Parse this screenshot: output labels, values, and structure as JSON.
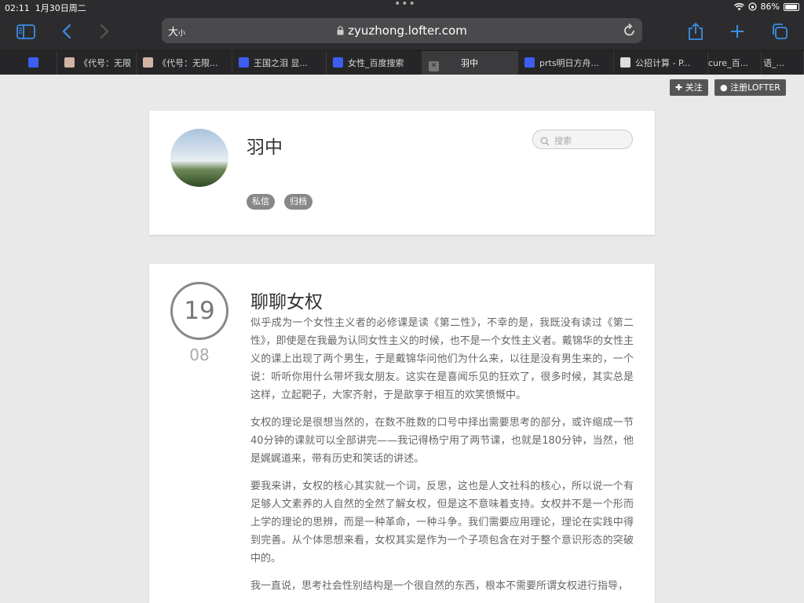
{
  "status": {
    "time": "02:11",
    "date": "1月30日周二",
    "battery": "86%",
    "battery_level": 0.86
  },
  "browser": {
    "text_size": "大",
    "text_size_small": "小",
    "url": "zyuzhong.lofter.com",
    "tabs": [
      {
        "label": "",
        "icon": "baidu-paw-icon"
      },
      {
        "label": "《代号：无限",
        "icon": "anime-avatar-icon"
      },
      {
        "label": "《代号：无限...",
        "icon": "anime-avatar-icon"
      },
      {
        "label": "王国之泪 显...",
        "icon": "baidu-paw-icon"
      },
      {
        "label": "女性_百度搜索",
        "icon": "baidu-paw-icon"
      },
      {
        "label": "羽中",
        "icon": "close-icon",
        "active": true
      },
      {
        "label": "prts明日方舟...",
        "icon": "baidu-paw-icon"
      },
      {
        "label": "公招计算 - P...",
        "icon": "page-icon"
      },
      {
        "label": "cure_百...",
        "icon": ""
      },
      {
        "label": "语_...",
        "icon": ""
      }
    ]
  },
  "lofter": {
    "follow_label": "关注",
    "register_label": "注册LOFTER"
  },
  "profile": {
    "name": "羽中",
    "search_placeholder": "搜索",
    "message_label": "私信",
    "archive_label": "归档"
  },
  "post": {
    "day": "19",
    "month": "08",
    "title": "聊聊女权",
    "paragraphs": [
      "似乎成为一个女性主义者的必修课是读《第二性》，不幸的是，我既没有读过《第二性》，即使是在我最为认同女性主义的时候，也不是一个女性主义者。戴锦华的女性主义的课上出现了两个男生，于是戴锦华问他们为什么来，以往是没有男生来的，一个说：听听你用什么带坏我女朋友。这实在是喜闻乐见的狂欢了，很多时候，其实总是这样，立起靶子，大家齐射，于是歆享于相互的欢笑愤慨中。",
      "女权的理论是很想当然的，在数不胜数的口号中择出需要思考的部分，或许缩成一节40分钟的课就可以全部讲完——我记得杨宁用了两节课，也就是180分钟，当然，他是娓娓道来，带有历史和笑话的讲述。",
      "要我来讲，女权的核心其实就一个词，反思，这也是人文社科的核心，所以说一个有足够人文素养的人自然的全然了解女权，但是这不意味着支持。女权并不是一个形而上学的理论的思辨，而是一种革命，一种斗争。我们需要应用理论，理论在实践中得到完善。从个体思想来看，女权其实是作为一个子项包含在对于整个意识形态的突破中的。",
      "我一直说，思考社会性别结构是一个很自然的东西，根本不需要所谓女权进行指导，"
    ]
  }
}
